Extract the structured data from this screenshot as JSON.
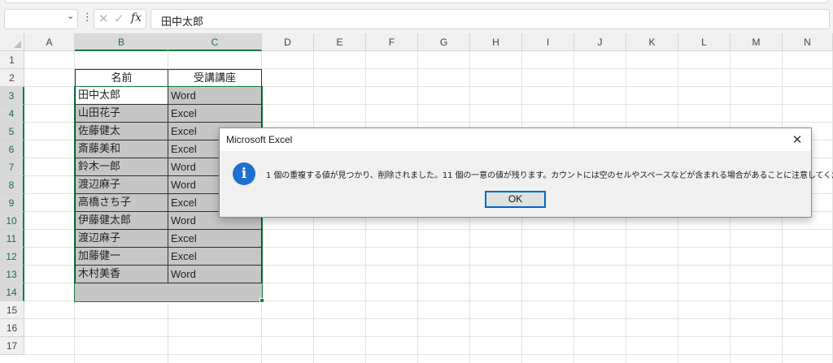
{
  "formula_bar": {
    "name_box_value": "",
    "cancel_glyph": "✕",
    "enter_glyph": "✓",
    "fx_label": "fx",
    "formula_value": "田中太郎"
  },
  "sheet": {
    "columns": [
      "A",
      "B",
      "C",
      "D",
      "E",
      "F",
      "G",
      "H",
      "I",
      "J",
      "K",
      "L",
      "M",
      "N"
    ],
    "rows": [
      "1",
      "2",
      "3",
      "4",
      "5",
      "6",
      "7",
      "8",
      "9",
      "10",
      "11",
      "12",
      "13",
      "14",
      "15",
      "16",
      "17"
    ],
    "selected_columns": [
      "B",
      "C"
    ],
    "selected_rows": [
      "3",
      "4",
      "5",
      "6",
      "7",
      "8",
      "9",
      "10",
      "11",
      "12",
      "13",
      "14"
    ],
    "selected_range": "B3:C14",
    "active_cell": "B3",
    "table": {
      "header": [
        "名前",
        "受講講座"
      ],
      "rows": [
        [
          "田中太郎",
          "Word"
        ],
        [
          "山田花子",
          "Excel"
        ],
        [
          "佐藤健太",
          "Excel"
        ],
        [
          "斎藤美和",
          "Excel"
        ],
        [
          "鈴木一郎",
          "Word"
        ],
        [
          "渡辺麻子",
          "Word"
        ],
        [
          "高橋さち子",
          "Excel"
        ],
        [
          "伊藤健太郎",
          "Word"
        ],
        [
          "渡辺麻子",
          "Excel"
        ],
        [
          "加藤健一",
          "Excel"
        ],
        [
          "木村美香",
          "Word"
        ]
      ]
    },
    "colors": {
      "selection_accent": "#107c41",
      "selection_fill": "#c6c6c6"
    }
  },
  "dialog": {
    "title": "Microsoft Excel",
    "close_glyph": "✕",
    "icon": "info-icon",
    "icon_glyph": "i",
    "icon_color": "#1f6fcf",
    "message": "1 個の重複する値が見つかり、削除されました。11 個の一意の値が残ります。カウントには空のセルやスペースなどが含まれる場合があることに注意してください。",
    "ok_label": "OK"
  }
}
